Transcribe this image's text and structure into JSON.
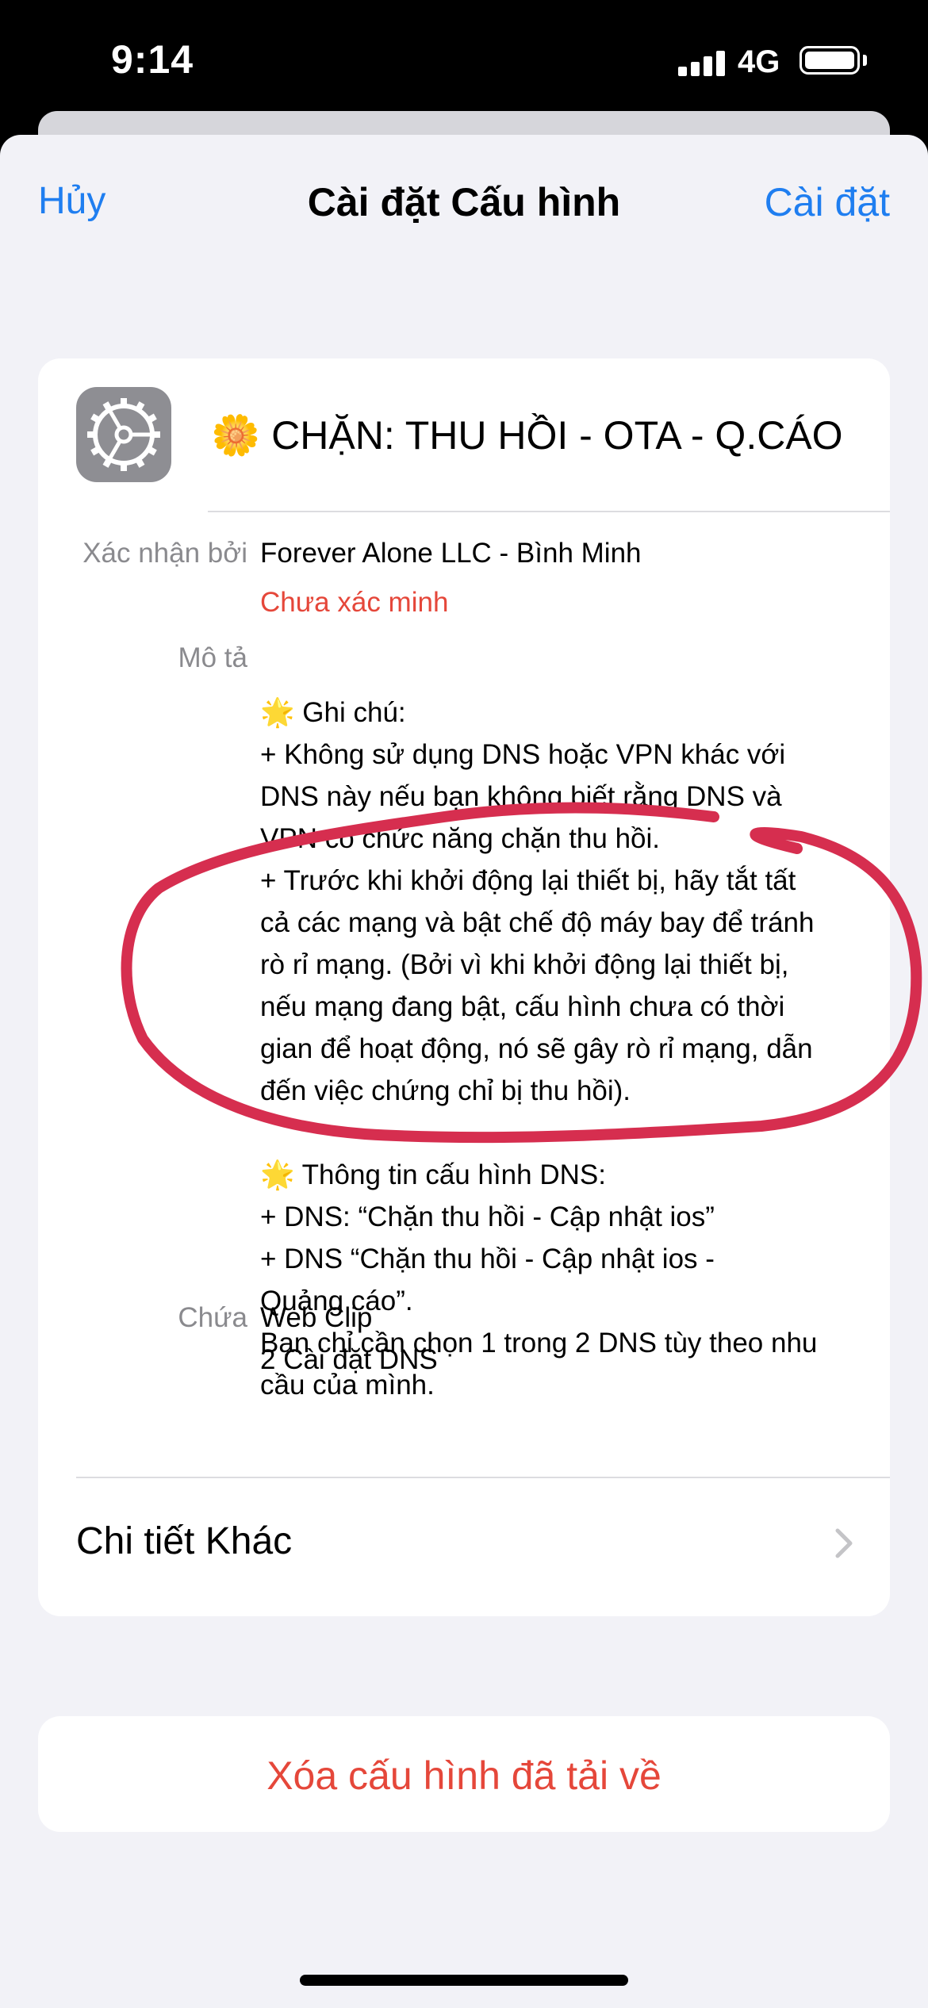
{
  "status_bar": {
    "time": "9:14",
    "network": "4G",
    "battery_level": 1.0
  },
  "nav": {
    "cancel": "Hủy",
    "title": "Cài đặt Cấu hình",
    "install": "Cài đặt"
  },
  "profile": {
    "icon": "settings-gear-icon",
    "name": "🌼 CHẶN: THU HỒI - OTA - Q.CÁO",
    "signed_by_label": "Xác nhận bởi",
    "signed_by": "Forever Alone LLC - Bình Minh",
    "verification": "Chưa xác minh",
    "description_label": "Mô tả",
    "description_lines": [
      "🌟 Ghi chú:",
      "+ Không sử dụng DNS hoặc VPN khác với",
      "DNS này nếu bạn không biết rằng DNS và",
      "VPN có chức năng chặn thu hồi.",
      "+ Trước khi khởi động lại thiết bị, hãy tắt tất",
      "cả các mạng và bật chế độ máy bay để tránh",
      "rò rỉ mạng. (Bởi vì khi khởi động lại thiết bị,",
      "nếu mạng đang bật, cấu hình chưa có thời",
      "gian để hoạt động, nó sẽ gây rò rỉ mạng, dẫn",
      "đến việc chứng chỉ bị thu hồi).",
      "",
      "🌟 Thông tin cấu hình DNS:",
      "+ DNS: “Chặn thu hồi - Cập nhật ios”",
      "+ DNS “Chặn thu hồi - Cập nhật ios -",
      "Quảng cáo”.",
      "Bạn chỉ cần chọn 1 trong 2 DNS tùy theo nhu",
      "cầu của mình."
    ],
    "contains_label": "Chứa",
    "contains": [
      "Web Clip",
      "2 Cài đặt DNS"
    ],
    "more_details": "Chi tiết Khác"
  },
  "remove_button": "Xóa cấu hình đã tải về",
  "colors": {
    "accent": "#1f7ef0",
    "destructive": "#e5473a",
    "annotation": "#d62e4f",
    "background": "#f2f2f7"
  }
}
